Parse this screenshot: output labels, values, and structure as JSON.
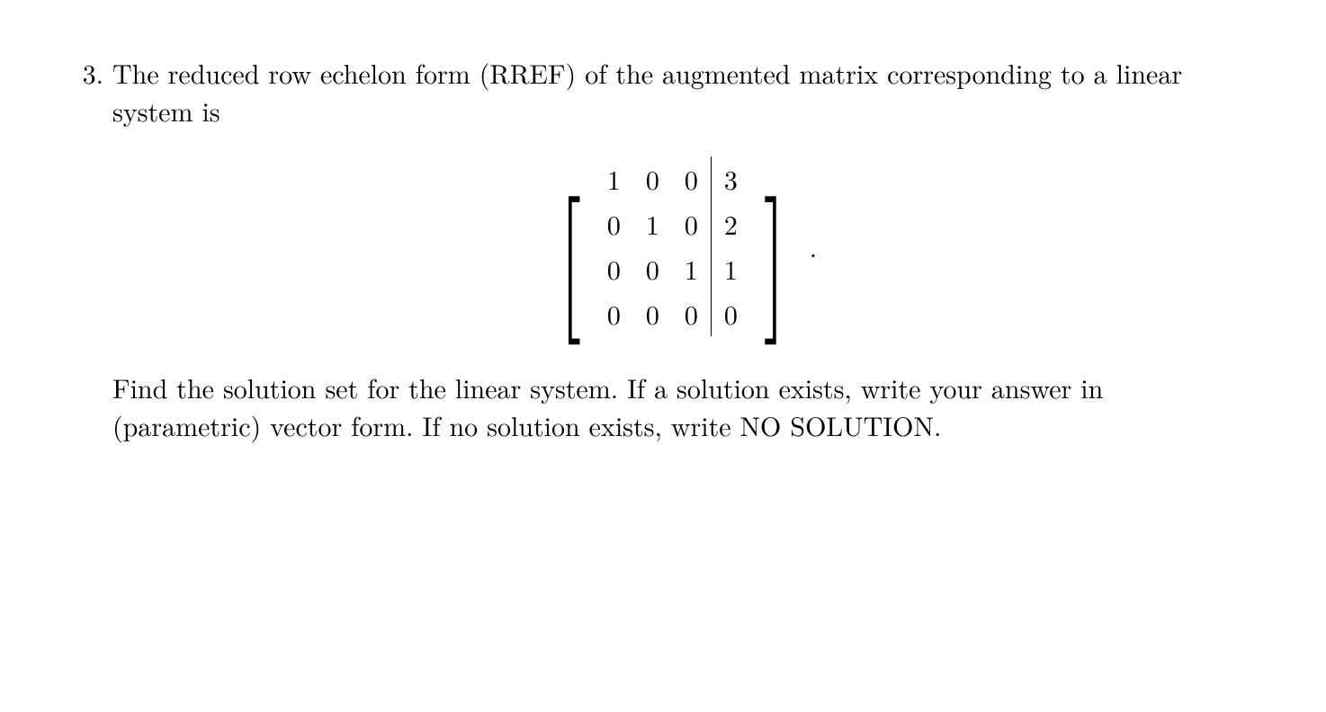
{
  "problem": {
    "number": "3.",
    "intro": "The reduced row echelon form (RREF) of the augmented matrix corresponding to a linear system is",
    "instruction": "Find the solution set for the linear system. If a solution exists, write your answer in (parametric) vector form. If no solution exists, write NO SOLUTION.",
    "period": "."
  },
  "matrix": {
    "rows": [
      {
        "c1": "1",
        "c2": "0",
        "c3": "0",
        "aug": "3"
      },
      {
        "c1": "0",
        "c2": "1",
        "c3": "0",
        "aug": "2"
      },
      {
        "c1": "0",
        "c2": "0",
        "c3": "1",
        "aug": "1"
      },
      {
        "c1": "0",
        "c2": "0",
        "c3": "0",
        "aug": "0"
      }
    ]
  }
}
